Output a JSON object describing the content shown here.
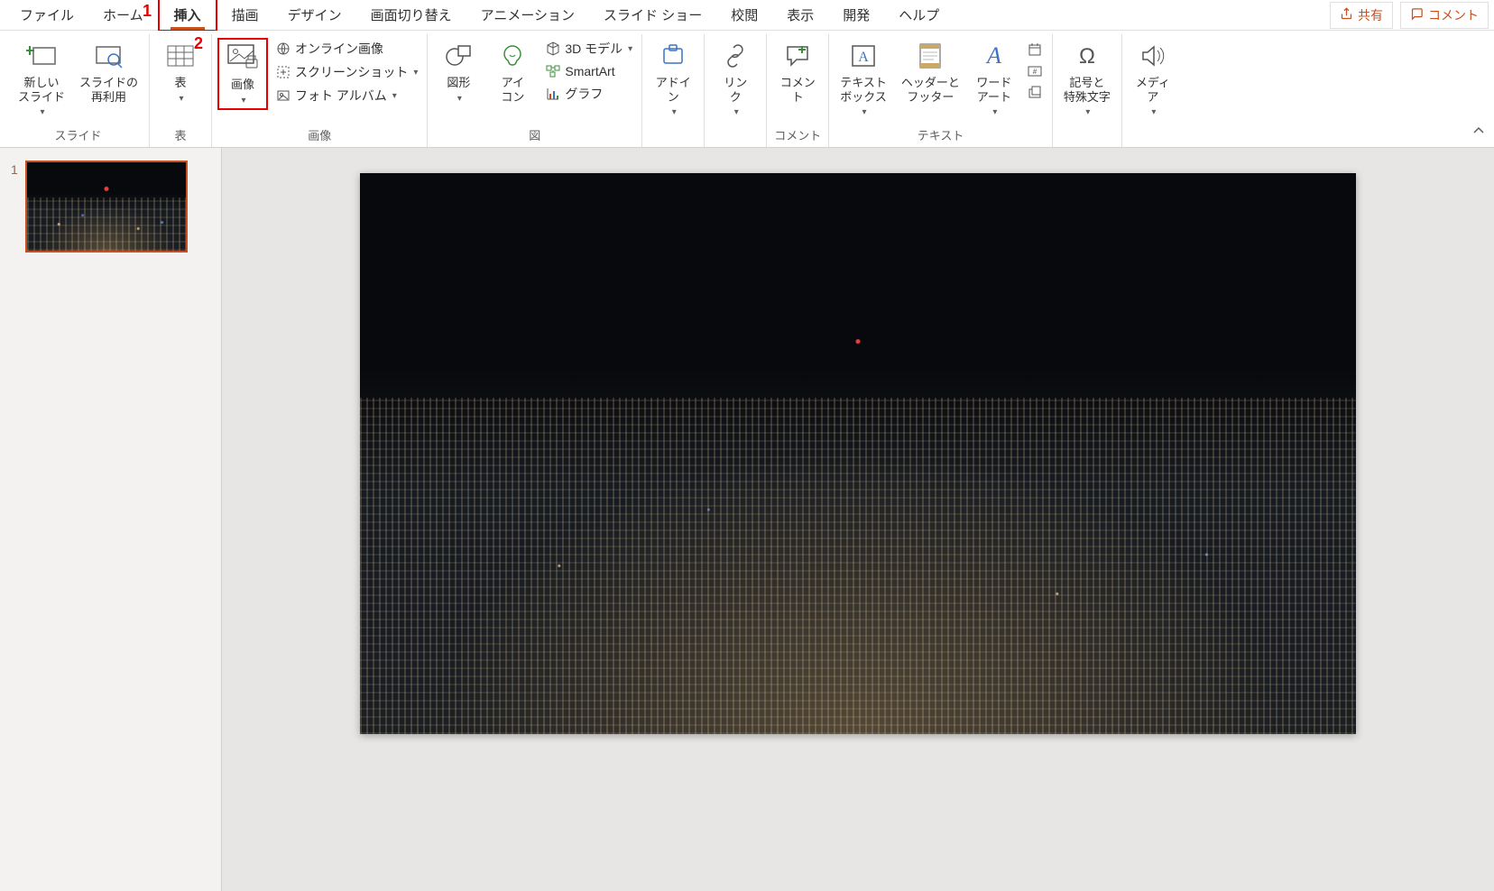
{
  "annotations": {
    "num1": "1",
    "num2": "2"
  },
  "tabs": {
    "items": [
      "ファイル",
      "ホーム",
      "挿入",
      "描画",
      "デザイン",
      "画面切り替え",
      "アニメーション",
      "スライド ショー",
      "校閲",
      "表示",
      "開発",
      "ヘルプ"
    ],
    "active_index": 2
  },
  "top_right": {
    "share": "共有",
    "comment": "コメント"
  },
  "ribbon": {
    "groups": {
      "slides": {
        "label": "スライド",
        "new_slide": "新しい\nスライド",
        "reuse_slides": "スライドの\n再利用"
      },
      "tables": {
        "label": "表",
        "table": "表"
      },
      "images": {
        "label": "画像",
        "picture": "画像",
        "online": "オンライン画像",
        "screenshot": "スクリーンショット",
        "album": "フォト アルバム"
      },
      "illustrations": {
        "label": "図",
        "shapes": "図形",
        "icons": "アイ\nコン",
        "model3d": "3D モデル",
        "smartart": "SmartArt",
        "chart": "グラフ"
      },
      "addins": {
        "label": "アドイ\nン"
      },
      "links": {
        "label": "リン\nク"
      },
      "comments": {
        "group_label": "コメント",
        "label": "コメン\nト"
      },
      "text": {
        "label": "テキスト",
        "textbox": "テキスト\nボックス",
        "headerfooter": "ヘッダーと\nフッター",
        "wordart": "ワード\nアート"
      },
      "symbols": {
        "label": "記号と\n特殊文字"
      },
      "media": {
        "label": "メディ\nア"
      }
    }
  },
  "thumbnails": {
    "items": [
      {
        "number": "1"
      }
    ]
  }
}
